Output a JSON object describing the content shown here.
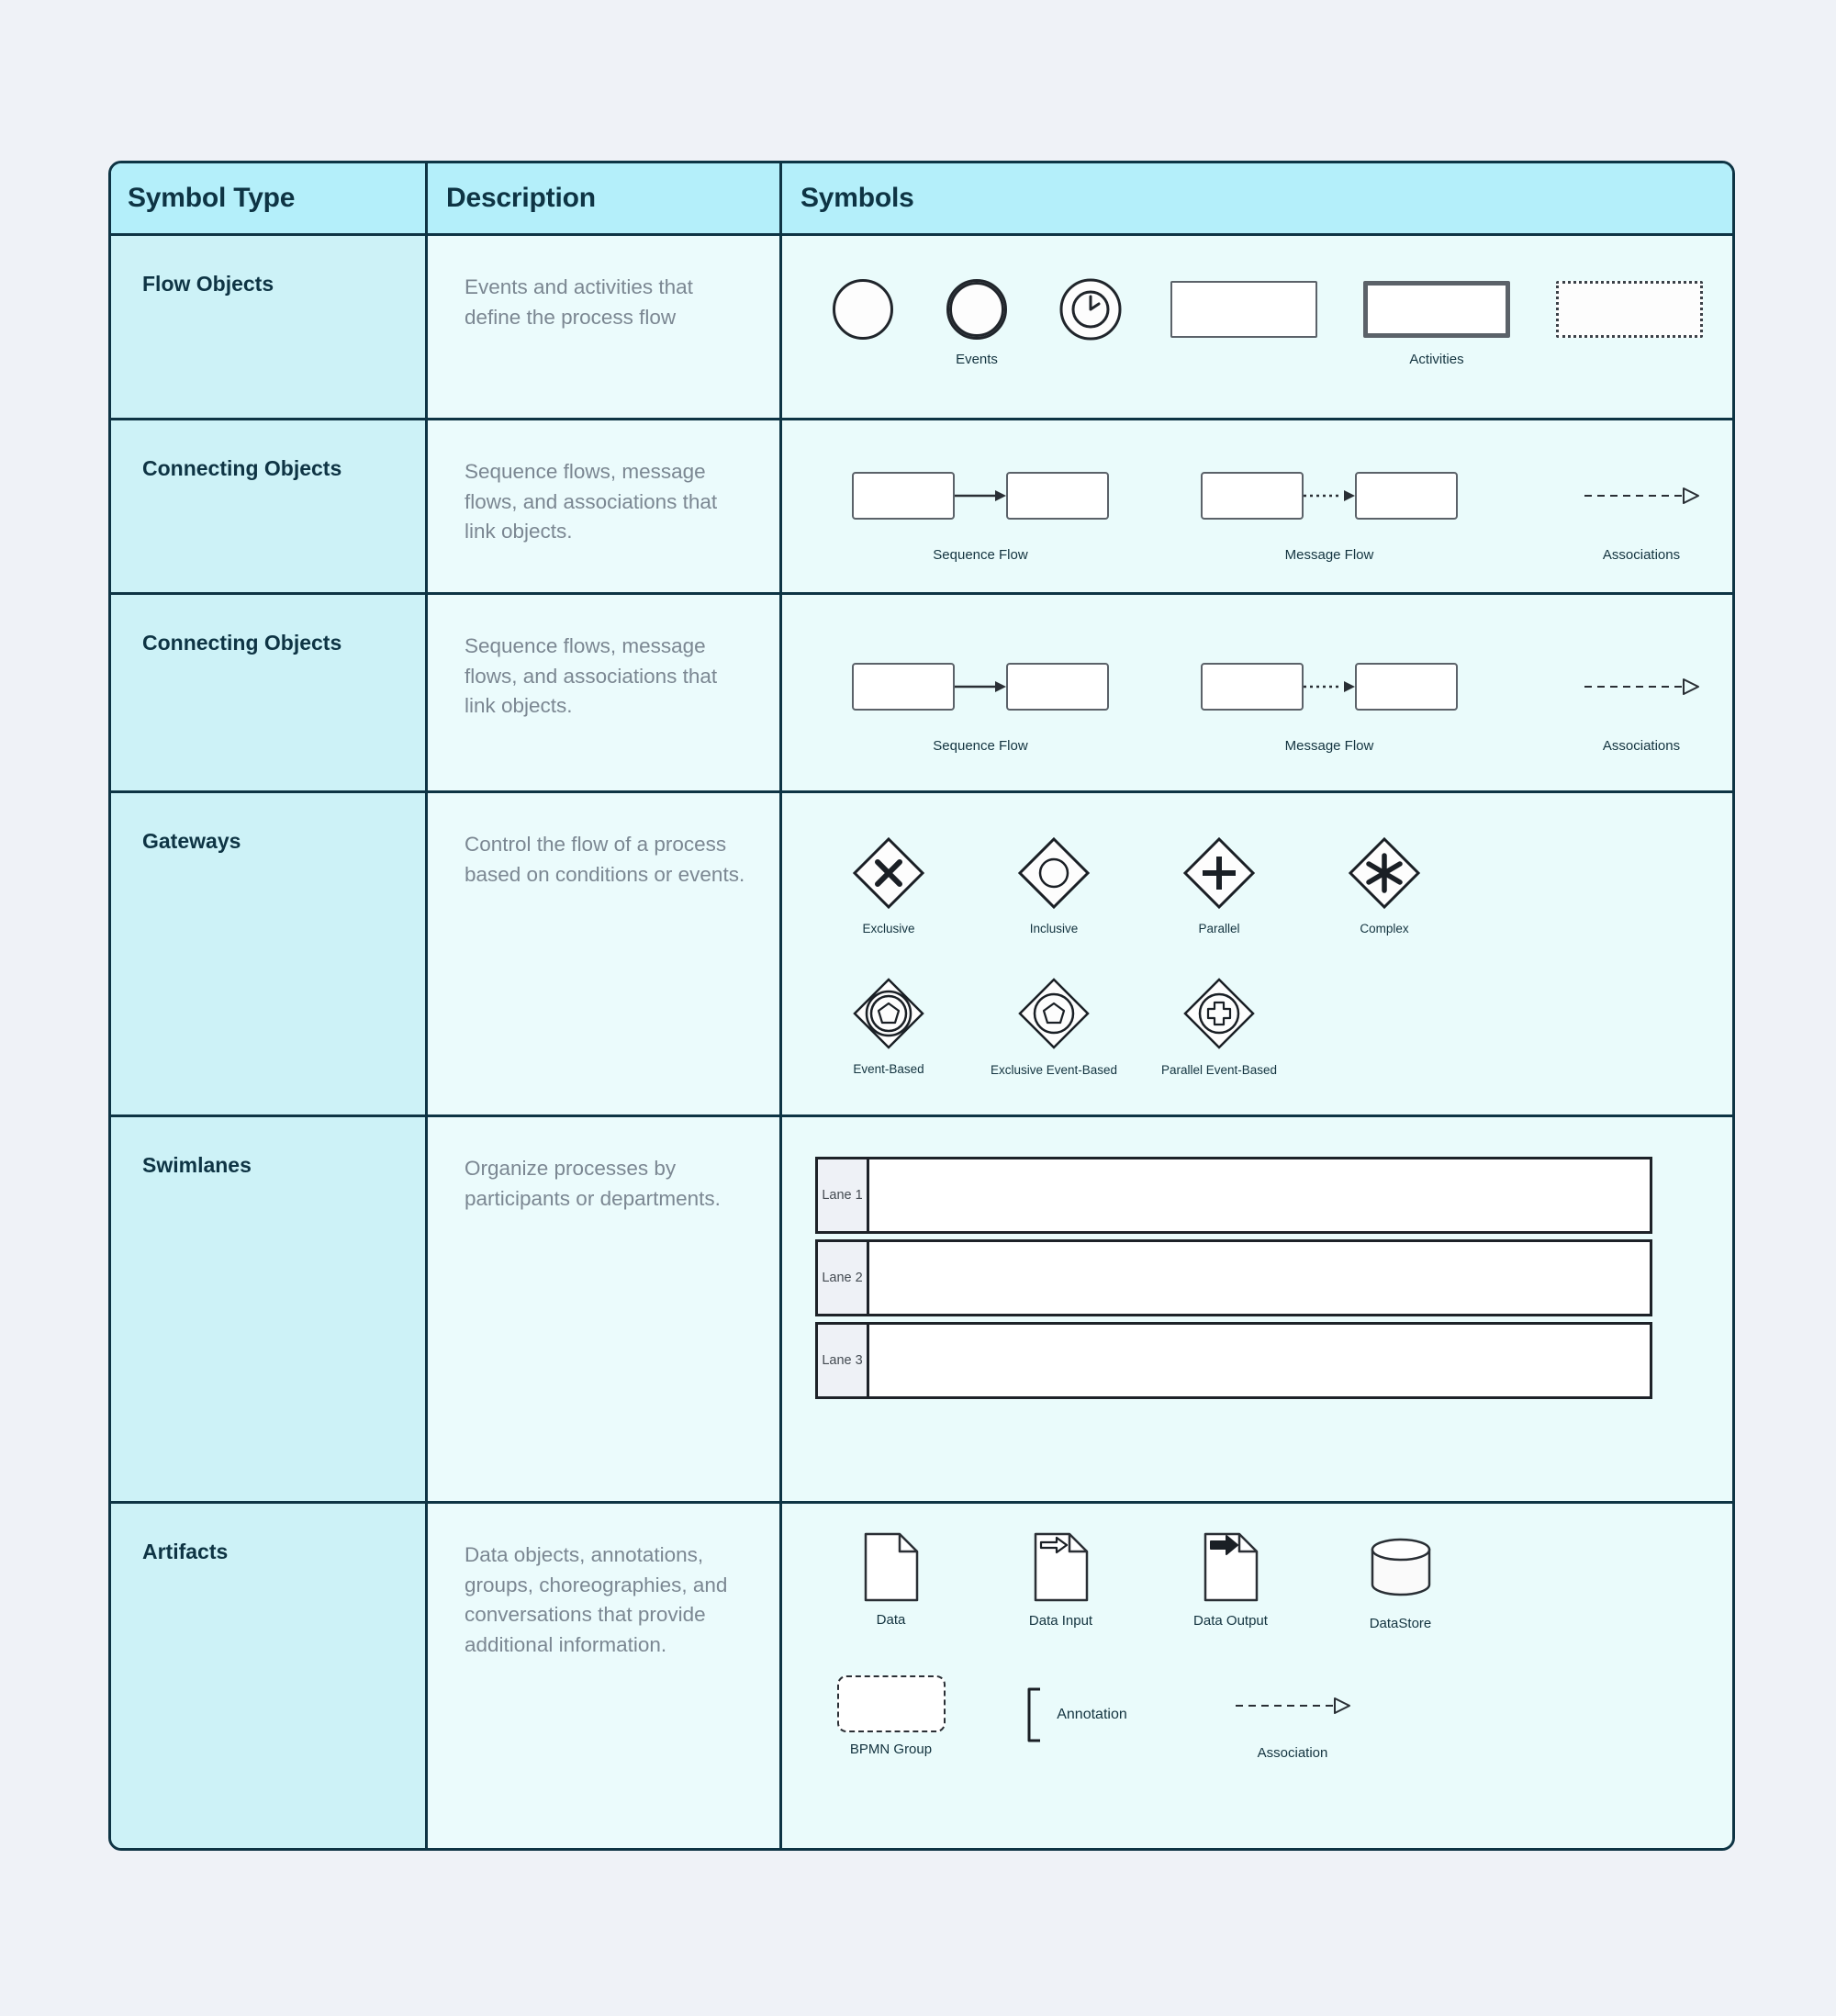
{
  "table": {
    "headers": {
      "type": "Symbol Type",
      "description": "Description",
      "symbols": "Symbols"
    },
    "colors": {
      "header_bg": "#b4effa",
      "type_bg": "#cdf2f7",
      "desc_bg": "#ebfbfc",
      "symbols_bg": "#eafbfb",
      "border": "#0e3444",
      "page_bg": "#eff2f7",
      "heading_text": "#0e3444",
      "desc_text": "#7b8792",
      "symbol_stroke": "#20252b"
    },
    "rows": [
      {
        "type": "Flow Objects",
        "description": "Events and activities that define the process flow",
        "group_labels": [
          "Events",
          "Activities"
        ],
        "symbols": [
          "start-event-circle",
          "intermediate-event-double-circle",
          "timer-event-clock-circle",
          "task-activity-thin-rect",
          "call-activity-thick-rect",
          "ad-hoc-activity-dotted-rect"
        ]
      },
      {
        "type": "Connecting Objects",
        "description": "Sequence flows, message flows, and associations that link objects.",
        "symbols": [
          {
            "label": "Sequence Flow",
            "kind": "solid-arrow-between-boxes"
          },
          {
            "label": "Message Flow",
            "kind": "dotted-arrow-between-boxes"
          },
          {
            "label": "Associations",
            "kind": "dashed-open-arrow"
          }
        ]
      },
      {
        "type": "Connecting Objects",
        "description": "Sequence flows, message flows, and associations that link objects.",
        "symbols": [
          {
            "label": "Sequence Flow",
            "kind": "solid-arrow-between-boxes"
          },
          {
            "label": "Message Flow",
            "kind": "dotted-arrow-between-boxes"
          },
          {
            "label": "Associations",
            "kind": "dashed-open-arrow"
          }
        ]
      },
      {
        "type": "Gateways",
        "description": "Control the flow of a process based on conditions or events.",
        "symbols_row1": [
          {
            "label": "Exclusive",
            "kind": "diamond-x"
          },
          {
            "label": "Inclusive",
            "kind": "diamond-circle"
          },
          {
            "label": "Parallel",
            "kind": "diamond-plus"
          },
          {
            "label": "Complex",
            "kind": "diamond-asterisk"
          }
        ],
        "symbols_row2": [
          {
            "label": "Event-Based",
            "kind": "diamond-double-circle-pentagon"
          },
          {
            "label": "Exclusive Event-Based",
            "kind": "diamond-circle-pentagon"
          },
          {
            "label": "Parallel Event-Based",
            "kind": "diamond-circle-plus-outline"
          }
        ]
      },
      {
        "type": "Swimlanes",
        "description": "Organize processes by participants or departments.",
        "lanes": [
          "Lane 1",
          "Lane 2",
          "Lane 3"
        ]
      },
      {
        "type": "Artifacts",
        "description": "Data objects, annotations, groups, choreographies, and conversations that provide additional information.",
        "symbols_row1": [
          {
            "label": "Data",
            "kind": "document-folded-corner"
          },
          {
            "label": "Data Input",
            "kind": "document-hollow-arrow"
          },
          {
            "label": "Data Output",
            "kind": "document-filled-arrow"
          },
          {
            "label": "DataStore",
            "kind": "cylinder-database"
          }
        ],
        "symbols_row2": [
          {
            "label": "BPMN Group",
            "kind": "dashed-rounded-rect"
          },
          {
            "label": "Annotation",
            "kind": "bracket-annotation"
          },
          {
            "label": "Association",
            "kind": "dashed-open-arrow"
          }
        ]
      }
    ]
  }
}
